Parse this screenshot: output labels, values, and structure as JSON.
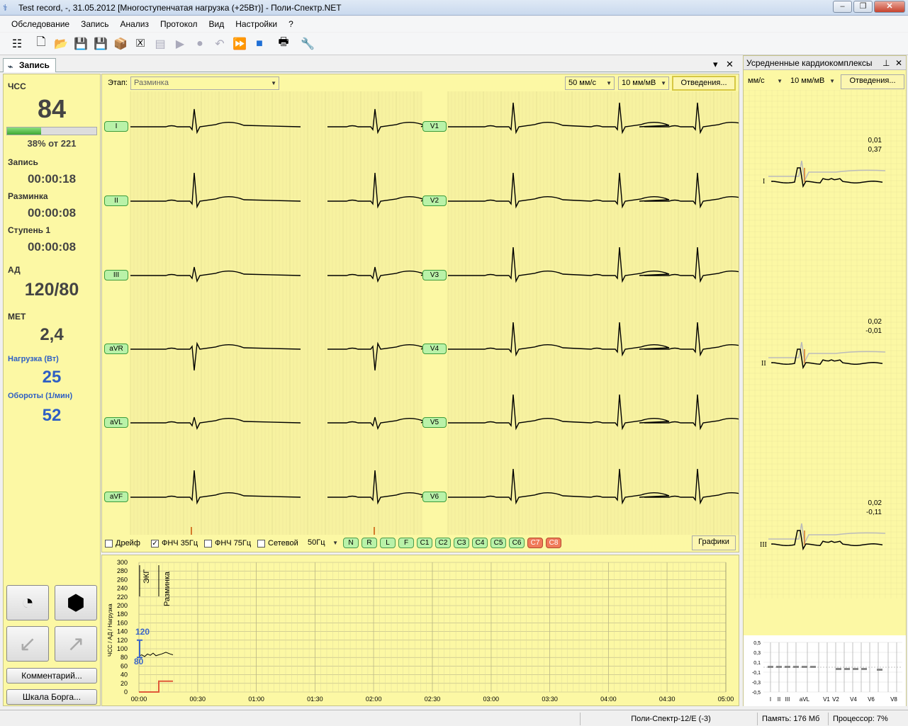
{
  "window": {
    "title": "Test record, -, 31.05.2012 [Многоступенчатая нагрузка (+25Вт)] - Поли-Спектр.NET",
    "min_glyph": "–",
    "max_glyph": "❐",
    "close_glyph": "✕"
  },
  "menu": [
    "Обследование",
    "Запись",
    "Анализ",
    "Протокол",
    "Вид",
    "Настройки",
    "?"
  ],
  "toolbar_icons": [
    "tree-icon",
    "new-record-icon",
    "open-record-icon",
    "save-icon",
    "save-all-icon",
    "archive-icon",
    "close-record-icon",
    "report-icon",
    "play-icon",
    "record-icon",
    "undo-icon",
    "fast-forward-icon",
    "stop-icon",
    "print-icon",
    "settings-icon"
  ],
  "doc_tab": {
    "label": "Запись",
    "pin": "▾",
    "close": "✕"
  },
  "left": {
    "hr_label": "ЧСС",
    "hr_value": "84",
    "hr_progress": 0.38,
    "hr_percent_text": "38% от 221",
    "rec_label": "Запись",
    "rec_time": "00:00:18",
    "warmup_label": "Разминка",
    "warmup_time": "00:00:08",
    "stage_label": "Ступень 1",
    "stage_time": "00:00:08",
    "bp_label": "АД",
    "bp_value": "120/80",
    "met_label": "МЕТ",
    "met_value": "2,4",
    "load_label": "Нагрузка (Вт)",
    "load_value": "25",
    "rpm_label": "Обороты (1/мин)",
    "rpm_value": "52",
    "comment_btn": "Комментарий...",
    "borg_btn": "Шкала Борга..."
  },
  "ecg": {
    "stage_label": "Этап:",
    "stage_value": "Разминка",
    "speed": "50 мм/с",
    "gain": "10 мм/мВ",
    "leads_btn": "Отведения...",
    "leads_left": [
      "I",
      "II",
      "III",
      "aVR",
      "aVL",
      "aVF"
    ],
    "leads_right": [
      "V1",
      "V2",
      "V3",
      "V4",
      "V5",
      "V6"
    ],
    "filters": [
      {
        "label": "Дрейф",
        "checked": false
      },
      {
        "label": "ФНЧ 35Гц",
        "checked": true
      },
      {
        "label": "ФНЧ 75Гц",
        "checked": false
      },
      {
        "label": "Сетевой",
        "checked": false
      }
    ],
    "net_freq": "50Гц",
    "markers": [
      "N",
      "R",
      "L",
      "F",
      "C1",
      "C2",
      "C3",
      "C4",
      "C5",
      "C6",
      "C7",
      "C8"
    ],
    "red_markers": [
      "C7",
      "C8"
    ],
    "graphs_btn": "Графики"
  },
  "trend": {
    "ylabel": "ЧСС / АД / Нагрузка",
    "yticks": [
      "300",
      "280",
      "260",
      "240",
      "220",
      "200",
      "180",
      "160",
      "140",
      "120",
      "100",
      "80",
      "60",
      "40",
      "20",
      "0"
    ],
    "xticks": [
      "00:00",
      "00:30",
      "01:00",
      "01:30",
      "02:00",
      "02:30",
      "03:00",
      "03:30",
      "04:00",
      "04:30",
      "05:00"
    ],
    "events": [
      "ЭКГ",
      "Разминка"
    ],
    "bp_sys": "120",
    "bp_dia": "80"
  },
  "right": {
    "title": "Усредненные кардиокомплексы",
    "pin": "⊥",
    "close": "✕",
    "speed": "мм/с",
    "gain": "10 мм/мВ",
    "leads_btn": "Отведения...",
    "complexes": [
      {
        "lead": "I",
        "v1": "0,01",
        "v2": "0,37"
      },
      {
        "lead": "II",
        "v1": "0,02",
        "v2": "-0,01"
      },
      {
        "lead": "III",
        "v1": "0,02",
        "v2": "-0,11"
      }
    ],
    "st_yticks": [
      "0,5",
      "0,3",
      "0,1",
      "-0,1",
      "-0,3",
      "-0,5"
    ],
    "st_xlabels": [
      "I",
      "II",
      "III",
      "aVL",
      "V1",
      "V2",
      "V4",
      "V6",
      "V8"
    ]
  },
  "status": {
    "device": "Поли-Спектр-12/Е (-3)",
    "memory": "Память: 176 Мб",
    "cpu": "Процессор: 7%"
  }
}
